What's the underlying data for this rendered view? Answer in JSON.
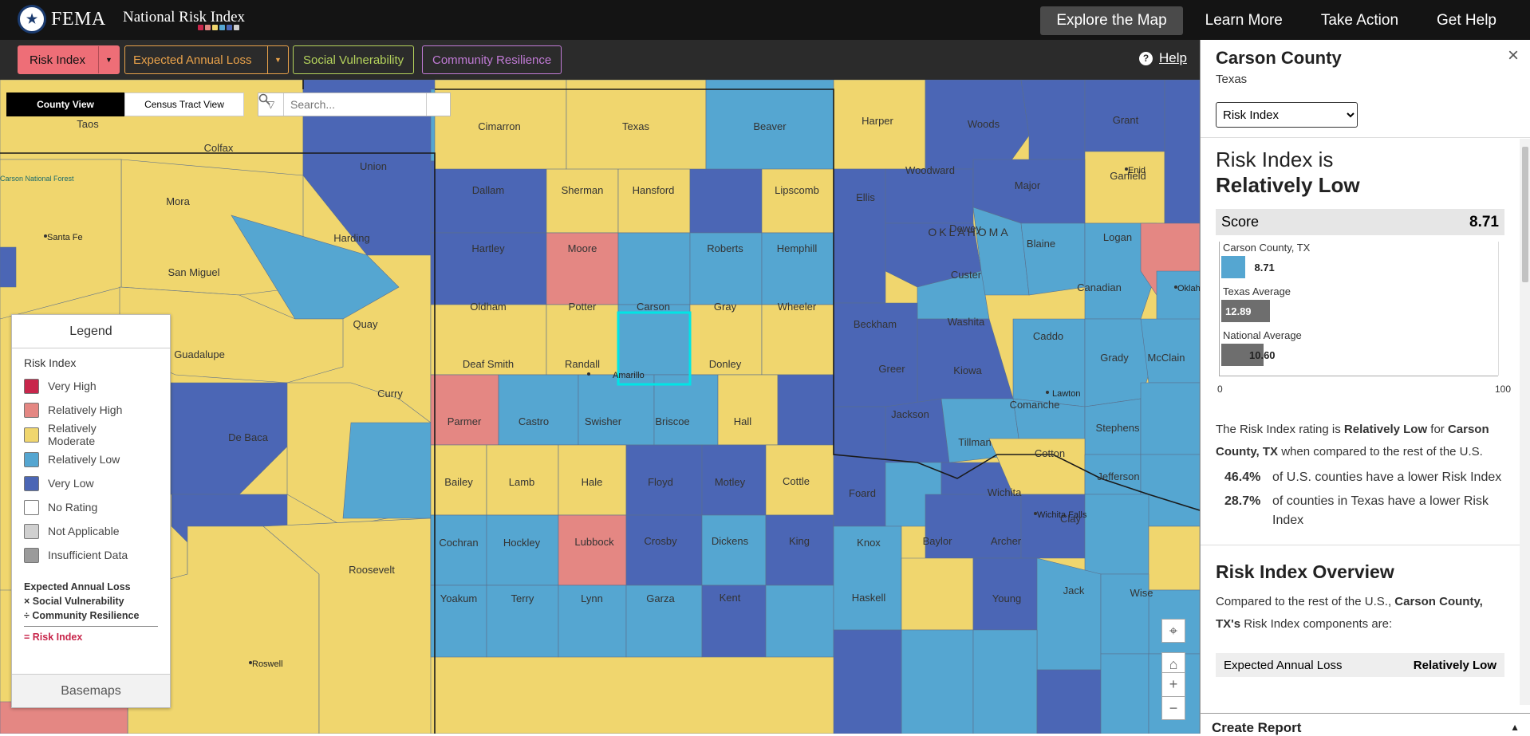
{
  "header": {
    "brand": "FEMA",
    "product": "National Risk Index",
    "brand_dots": [
      "#c8264b",
      "#e48783",
      "#f0d66e",
      "#55a6d1",
      "#4b66b5",
      "#cfcfcf"
    ],
    "nav": [
      {
        "label": "Explore the Map",
        "active": true
      },
      {
        "label": "Learn More",
        "active": false
      },
      {
        "label": "Take Action",
        "active": false
      },
      {
        "label": "Get Help",
        "active": false
      }
    ]
  },
  "toolbar": {
    "tabs": [
      {
        "label": "Risk Index",
        "color": "#ee6e77"
      },
      {
        "label": "Expected Annual Loss",
        "color": "#e8a14a"
      },
      {
        "label": "Social Vulnerability",
        "color": "#b5d35c"
      },
      {
        "label": "Community Resilience",
        "color": "#c17bd6"
      }
    ],
    "help_label": "Help"
  },
  "map": {
    "view_toggle": [
      "County View",
      "Census Tract View"
    ],
    "search_placeholder": "Search...",
    "colors": {
      "very_high": "#c8264b",
      "rel_high": "#e48783",
      "rel_moderate": "#f0d66e",
      "rel_low": "#55a6d1",
      "very_low": "#4b66b5",
      "state_line": "#1a1a1a",
      "selected": "#00e5e5"
    },
    "state_label": "OKLAHOMA",
    "city_labels": [
      "Santa Fe",
      "Amarillo",
      "Enid",
      "Lawton",
      "Wichita Falls",
      "Roswell",
      "Oklahoma",
      "Lubbock",
      "Carson National Forest"
    ],
    "selected_county": "Carson"
  },
  "legend": {
    "title": "Legend",
    "heading": "Risk Index",
    "items": [
      {
        "label": "Very High",
        "color": "#c8264b"
      },
      {
        "label": "Relatively High",
        "color": "#e48783"
      },
      {
        "label": "Relatively Moderate",
        "color": "#f0d66e"
      },
      {
        "label": "Relatively Low",
        "color": "#55a6d1"
      },
      {
        "label": "Very Low",
        "color": "#4b66b5"
      },
      {
        "label": "No Rating",
        "color": "#ffffff"
      },
      {
        "label": "Not Applicable",
        "color": "#d0d0d0"
      },
      {
        "label": "Insufficient Data",
        "color": "#9b9b9b"
      }
    ],
    "formula": [
      "Expected Annual Loss",
      "× Social Vulnerability",
      "÷ Community Resilience",
      "= Risk Index"
    ],
    "basemaps": "Basemaps"
  },
  "panel": {
    "title": "Carson County",
    "state": "Texas",
    "select_value": "Risk Index",
    "rating_line1": "Risk Index is",
    "rating_line2": "Relatively Low",
    "score_label": "Score",
    "score_value": "8.71",
    "bars": [
      {
        "label": "Carson County, TX",
        "value": 8.71,
        "text": "8.71",
        "color": "#55a6d1"
      },
      {
        "label": "Texas Average",
        "value": 12.89,
        "text": "12.89",
        "color": "#6e6e6e"
      },
      {
        "label": "National Average",
        "value": 10.6,
        "text": "10.60",
        "color": "#6e6e6e"
      }
    ],
    "axis_min": "0",
    "axis_max": "100",
    "summary": {
      "pre": "The Risk Index rating is ",
      "rating": "Relatively Low",
      "mid": " for ",
      "county": "Carson County, TX",
      "post": " when compared to the rest of the U.S."
    },
    "stats": [
      {
        "pct": "46.4%",
        "text": "of U.S. counties have a lower Risk Index"
      },
      {
        "pct": "28.7%",
        "text": "of counties in Texas have a lower Risk Index"
      }
    ],
    "overview_title": "Risk Index Overview",
    "overview_text": {
      "pre": "Compared to the rest of the U.S., ",
      "county": "Carson County, TX's",
      "post": " Risk Index components are:"
    },
    "component": {
      "label": "Expected Annual Loss",
      "value": "Relatively Low"
    },
    "footer": "Create Report"
  }
}
